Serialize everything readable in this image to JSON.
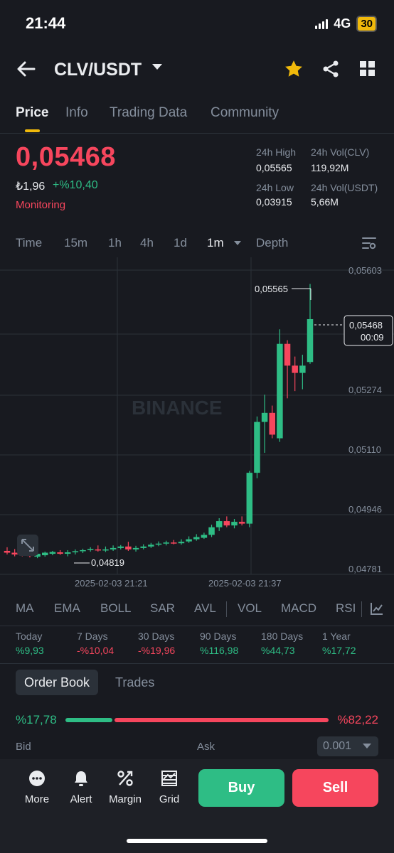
{
  "status": {
    "time": "21:44",
    "network": "4G",
    "battery": "30"
  },
  "header": {
    "pair": "CLV/USDT"
  },
  "tabs": [
    "Price",
    "Info",
    "Trading Data",
    "Community"
  ],
  "price": {
    "last": "0,05468",
    "fiat": "₺1,96",
    "change": "+%10,40",
    "monitor_label": "Monitoring"
  },
  "stats": {
    "high_label": "24h High",
    "high_value": "0,05565",
    "low_label": "24h Low",
    "low_value": "0,03915",
    "vol_base_label": "24h Vol(CLV)",
    "vol_base_value": "119,92M",
    "vol_quote_label": "24h Vol(USDT)",
    "vol_quote_value": "5,66M"
  },
  "intervals": {
    "items": [
      "Time",
      "15m",
      "1h",
      "4h",
      "1d",
      "1m",
      "Depth"
    ],
    "active": "1m"
  },
  "chart_data": {
    "type": "candlestick",
    "watermark": "BINANCE",
    "y_ticks": [
      "0,05603",
      "0,05274",
      "0,05110",
      "0,04946",
      "0,04781"
    ],
    "ylim": [
      0.04781,
      0.05603
    ],
    "x_ticks": [
      "2025-02-03 21:21",
      "2025-02-03 21:37"
    ],
    "max_label": "0,05565",
    "min_label": "0,04819",
    "current_price_label": "0,05468",
    "countdown": "00:09",
    "colors": {
      "up": "#2ebd85",
      "down": "#f6465d"
    },
    "candles": [
      {
        "o": 0.0483,
        "h": 0.0484,
        "l": 0.0482,
        "c": 0.04825
      },
      {
        "o": 0.04825,
        "h": 0.04835,
        "l": 0.04815,
        "c": 0.0482
      },
      {
        "o": 0.0482,
        "h": 0.0483,
        "l": 0.04815,
        "c": 0.04818
      },
      {
        "o": 0.0482,
        "h": 0.0483,
        "l": 0.04812,
        "c": 0.04816
      },
      {
        "o": 0.04814,
        "h": 0.04825,
        "l": 0.0481,
        "c": 0.04822
      },
      {
        "o": 0.04818,
        "h": 0.04828,
        "l": 0.04814,
        "c": 0.04825
      },
      {
        "o": 0.04822,
        "h": 0.0483,
        "l": 0.04818,
        "c": 0.04827
      },
      {
        "o": 0.04826,
        "h": 0.04832,
        "l": 0.04819,
        "c": 0.04822
      },
      {
        "o": 0.04822,
        "h": 0.04832,
        "l": 0.04815,
        "c": 0.04826
      },
      {
        "o": 0.04826,
        "h": 0.04834,
        "l": 0.0482,
        "c": 0.04829
      },
      {
        "o": 0.04829,
        "h": 0.04836,
        "l": 0.04824,
        "c": 0.04832
      },
      {
        "o": 0.04832,
        "h": 0.0484,
        "l": 0.04828,
        "c": 0.04835
      },
      {
        "o": 0.04834,
        "h": 0.04845,
        "l": 0.04828,
        "c": 0.04831
      },
      {
        "o": 0.04831,
        "h": 0.04842,
        "l": 0.04827,
        "c": 0.04834
      },
      {
        "o": 0.04834,
        "h": 0.04845,
        "l": 0.0483,
        "c": 0.04838
      },
      {
        "o": 0.04838,
        "h": 0.04846,
        "l": 0.04834,
        "c": 0.04842
      },
      {
        "o": 0.04842,
        "h": 0.04855,
        "l": 0.0483,
        "c": 0.04834
      },
      {
        "o": 0.04834,
        "h": 0.04844,
        "l": 0.04828,
        "c": 0.04838
      },
      {
        "o": 0.04838,
        "h": 0.04848,
        "l": 0.04834,
        "c": 0.04842
      },
      {
        "o": 0.04842,
        "h": 0.04852,
        "l": 0.04838,
        "c": 0.04847
      },
      {
        "o": 0.04847,
        "h": 0.04856,
        "l": 0.04843,
        "c": 0.0485
      },
      {
        "o": 0.0485,
        "h": 0.04858,
        "l": 0.04845,
        "c": 0.04853
      },
      {
        "o": 0.04853,
        "h": 0.0486,
        "l": 0.04848,
        "c": 0.04851
      },
      {
        "o": 0.04851,
        "h": 0.04862,
        "l": 0.04847,
        "c": 0.04855
      },
      {
        "o": 0.04856,
        "h": 0.0487,
        "l": 0.04852,
        "c": 0.04862
      },
      {
        "o": 0.04862,
        "h": 0.04876,
        "l": 0.04858,
        "c": 0.04868
      },
      {
        "o": 0.04866,
        "h": 0.0488,
        "l": 0.04863,
        "c": 0.04874
      },
      {
        "o": 0.04874,
        "h": 0.04902,
        "l": 0.04868,
        "c": 0.04895
      },
      {
        "o": 0.04895,
        "h": 0.0492,
        "l": 0.04885,
        "c": 0.04912
      },
      {
        "o": 0.04912,
        "h": 0.04925,
        "l": 0.04895,
        "c": 0.049
      },
      {
        "o": 0.049,
        "h": 0.04918,
        "l": 0.04892,
        "c": 0.0491
      },
      {
        "o": 0.0491,
        "h": 0.04925,
        "l": 0.049,
        "c": 0.04905
      },
      {
        "o": 0.04905,
        "h": 0.0505,
        "l": 0.04895,
        "c": 0.05045
      },
      {
        "o": 0.05045,
        "h": 0.052,
        "l": 0.0503,
        "c": 0.05185
      },
      {
        "o": 0.05185,
        "h": 0.0526,
        "l": 0.051,
        "c": 0.0521
      },
      {
        "o": 0.0521,
        "h": 0.0523,
        "l": 0.0514,
        "c": 0.0515
      },
      {
        "o": 0.0514,
        "h": 0.0544,
        "l": 0.0513,
        "c": 0.054
      },
      {
        "o": 0.054,
        "h": 0.0541,
        "l": 0.0525,
        "c": 0.0534
      },
      {
        "o": 0.0534,
        "h": 0.05365,
        "l": 0.0527,
        "c": 0.0532
      },
      {
        "o": 0.0532,
        "h": 0.0537,
        "l": 0.05275,
        "c": 0.0534
      },
      {
        "o": 0.0535,
        "h": 0.05565,
        "l": 0.05345,
        "c": 0.05468
      }
    ]
  },
  "indicators": [
    "MA",
    "EMA",
    "BOLL",
    "SAR",
    "AVL",
    "VOL",
    "MACD",
    "RSI"
  ],
  "performance": [
    {
      "label": "Today",
      "value": "%9,93",
      "dir": "up"
    },
    {
      "label": "7 Days",
      "value": "-%10,04",
      "dir": "down"
    },
    {
      "label": "30 Days",
      "value": "-%19,96",
      "dir": "down"
    },
    {
      "label": "90 Days",
      "value": "%116,98",
      "dir": "up"
    },
    {
      "label": "180 Days",
      "value": "%44,73",
      "dir": "up"
    },
    {
      "label": "1 Year",
      "value": "%17,72",
      "dir": "up"
    }
  ],
  "order_book": {
    "tab_order_book": "Order Book",
    "tab_trades": "Trades",
    "bid_pct": "%17,78",
    "ask_pct": "%82,22",
    "bid_ratio": 0.1778,
    "bid_label": "Bid",
    "ask_label": "Ask",
    "precision": "0.001"
  },
  "bottom_bar": {
    "more": "More",
    "alert": "Alert",
    "margin": "Margin",
    "grid": "Grid",
    "buy": "Buy",
    "sell": "Sell"
  }
}
